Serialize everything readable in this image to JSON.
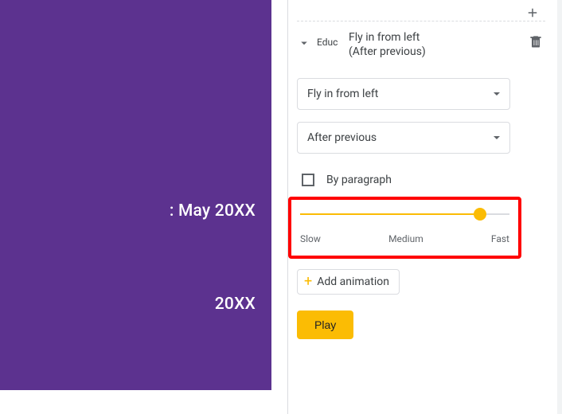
{
  "slide": {
    "text1": ": May 20XX",
    "text2": "20XX"
  },
  "animation": {
    "element_name": "Educ",
    "title": "Fly in from left",
    "trigger": "(After previous)"
  },
  "selects": {
    "type": "Fly in from left",
    "trigger": "After previous"
  },
  "checkbox": {
    "label": "By paragraph",
    "checked": false
  },
  "slider": {
    "slow": "Slow",
    "medium": "Medium",
    "fast": "Fast",
    "value_pct": 86
  },
  "buttons": {
    "add_animation": "Add animation",
    "play": "Play"
  }
}
